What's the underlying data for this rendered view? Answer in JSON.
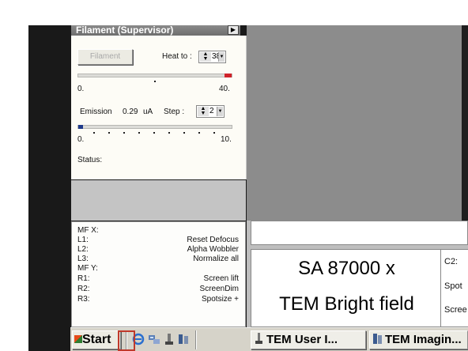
{
  "filament_panel": {
    "title": "Filament (Supervisor)",
    "filament_button": "Filament",
    "heat_to_label": "Heat to :",
    "heat_to_value": "38",
    "heat_scale_min": "0.",
    "heat_scale_max": "40.",
    "emission_label": "Emission",
    "emission_value": "0.29",
    "emission_unit": "uA",
    "step_label": "Step :",
    "step_value": "2",
    "step_scale_min": "0.",
    "step_scale_max": "10.",
    "status_label": "Status:"
  },
  "mf_panel": {
    "rows": [
      {
        "key": "MF X:",
        "value": ""
      },
      {
        "key": "L1:",
        "value": "Reset Defocus"
      },
      {
        "key": "L2:",
        "value": "Alpha Wobbler"
      },
      {
        "key": "L3:",
        "value": "Normalize all"
      },
      {
        "key": "MF Y:",
        "value": ""
      },
      {
        "key": "R1:",
        "value": "Screen lift"
      },
      {
        "key": "R2:",
        "value": "ScreenDim"
      },
      {
        "key": "R3:",
        "value": "Spotsize +"
      }
    ]
  },
  "info_panel": {
    "magnification": "SA 87000 x",
    "mode": "TEM Bright field",
    "side_c2": "C2:",
    "side_spot": "Spot",
    "side_screen": "Scree"
  },
  "taskbar": {
    "start_label": "Start",
    "tasks": [
      "TEM User I...",
      "TEM Imagin..."
    ]
  },
  "colors": {
    "highlight": "#c0392b",
    "heat_indicator": "#d0232a",
    "step_indicator": "#1f3a8a"
  },
  "icons": [
    "ie-icon",
    "network-icon",
    "tem-icon",
    "imaging-icon",
    "right-arrow-icon"
  ]
}
